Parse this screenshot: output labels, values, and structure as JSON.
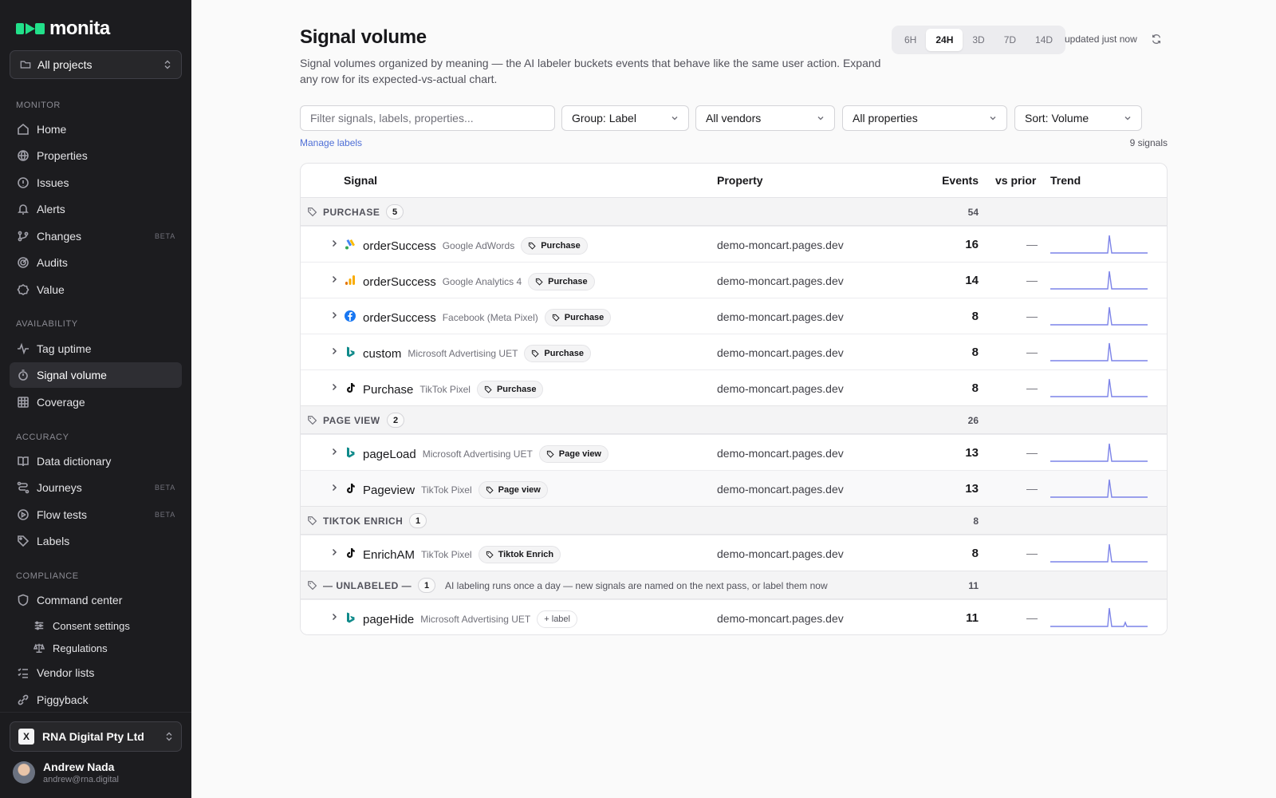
{
  "app": {
    "name": "monita",
    "brand_color": "#22e08a"
  },
  "project_selector": {
    "label": "All projects"
  },
  "nav": {
    "monitor": {
      "title": "MONITOR",
      "items": [
        {
          "label": "Home",
          "icon": "home-icon"
        },
        {
          "label": "Properties",
          "icon": "globe-icon"
        },
        {
          "label": "Issues",
          "icon": "alert-circle-icon"
        },
        {
          "label": "Alerts",
          "icon": "bell-icon"
        },
        {
          "label": "Changes",
          "icon": "git-branch-icon",
          "badge": "BETA"
        },
        {
          "label": "Audits",
          "icon": "target-icon"
        },
        {
          "label": "Value",
          "icon": "badge-icon"
        }
      ]
    },
    "availability": {
      "title": "AVAILABILITY",
      "items": [
        {
          "label": "Tag uptime",
          "icon": "activity-icon"
        },
        {
          "label": "Signal volume",
          "icon": "stopwatch-icon",
          "active": true
        },
        {
          "label": "Coverage",
          "icon": "grid-icon"
        }
      ]
    },
    "accuracy": {
      "title": "ACCURACY",
      "items": [
        {
          "label": "Data dictionary",
          "icon": "book-icon"
        },
        {
          "label": "Journeys",
          "icon": "route-icon",
          "badge": "BETA"
        },
        {
          "label": "Flow tests",
          "icon": "play-circle-icon",
          "badge": "BETA"
        },
        {
          "label": "Labels",
          "icon": "tag-icon"
        }
      ]
    },
    "compliance": {
      "title": "COMPLIANCE",
      "items": [
        {
          "label": "Command center",
          "icon": "shield-icon"
        },
        {
          "label": "Consent settings",
          "icon": "sliders-icon"
        },
        {
          "label": "Regulations",
          "icon": "scale-icon"
        },
        {
          "label": "Vendor lists",
          "icon": "list-check-icon"
        },
        {
          "label": "Piggyback",
          "icon": "chain-icon"
        }
      ]
    }
  },
  "org": {
    "name": "RNA Digital Pty Ltd",
    "logo_text": "X"
  },
  "user": {
    "name": "Andrew Nada",
    "email": "andrew@rna.digital"
  },
  "page": {
    "title": "Signal volume",
    "subtitle": "Signal volumes organized by meaning — the AI labeler buckets events that behave like the same user action. Expand any row for its expected-vs-actual chart.",
    "ranges": [
      "6H",
      "24H",
      "3D",
      "7D",
      "14D"
    ],
    "active_range": "24H",
    "updated": "updated just now"
  },
  "toolbar": {
    "filter_placeholder": "Filter signals, labels, properties...",
    "group": "Group: Label",
    "vendors": "All vendors",
    "properties": "All properties",
    "sort": "Sort: Volume",
    "manage_labels": "Manage labels",
    "signal_count": "9 signals"
  },
  "table": {
    "columns": {
      "signal": "Signal",
      "property": "Property",
      "events": "Events",
      "vs_prior": "vs prior",
      "trend": "Trend"
    },
    "groups": [
      {
        "name": "PURCHASE",
        "count": "5",
        "total": "54",
        "rows": [
          {
            "signal": "orderSuccess",
            "vendor": "Google AdWords",
            "vendor_icon": "google-ads-icon",
            "label": "Purchase",
            "property": "demo-moncart.pages.dev",
            "events": "16",
            "vs": "—"
          },
          {
            "signal": "orderSuccess",
            "vendor": "Google Analytics 4",
            "vendor_icon": "google-analytics-icon",
            "label": "Purchase",
            "property": "demo-moncart.pages.dev",
            "events": "14",
            "vs": "—"
          },
          {
            "signal": "orderSuccess",
            "vendor": "Facebook (Meta Pixel)",
            "vendor_icon": "facebook-icon",
            "label": "Purchase",
            "property": "demo-moncart.pages.dev",
            "events": "8",
            "vs": "—"
          },
          {
            "signal": "custom",
            "vendor": "Microsoft Advertising UET",
            "vendor_icon": "bing-icon",
            "label": "Purchase",
            "property": "demo-moncart.pages.dev",
            "events": "8",
            "vs": "—"
          },
          {
            "signal": "Purchase",
            "vendor": "TikTok Pixel",
            "vendor_icon": "tiktok-icon",
            "label": "Purchase",
            "property": "demo-moncart.pages.dev",
            "events": "8",
            "vs": "—"
          }
        ]
      },
      {
        "name": "PAGE VIEW",
        "count": "2",
        "total": "26",
        "rows": [
          {
            "signal": "pageLoad",
            "vendor": "Microsoft Advertising UET",
            "vendor_icon": "bing-icon",
            "label": "Page view",
            "property": "demo-moncart.pages.dev",
            "events": "13",
            "vs": "—"
          },
          {
            "signal": "Pageview",
            "vendor": "TikTok Pixel",
            "vendor_icon": "tiktok-icon",
            "label": "Page view",
            "property": "demo-moncart.pages.dev",
            "events": "13",
            "vs": "—"
          }
        ]
      },
      {
        "name": "TIKTOK ENRICH",
        "count": "1",
        "total": "8",
        "rows": [
          {
            "signal": "EnrichAM",
            "vendor": "TikTok Pixel",
            "vendor_icon": "tiktok-icon",
            "label": "Tiktok Enrich",
            "property": "demo-moncart.pages.dev",
            "events": "8",
            "vs": "—"
          }
        ]
      },
      {
        "name": "— UNLABELED —",
        "count": "1",
        "total": "11",
        "note": "AI labeling runs once a day — new signals are named on the next pass, or label them now",
        "rows": [
          {
            "signal": "pageHide",
            "vendor": "Microsoft Advertising UET",
            "vendor_icon": "bing-icon",
            "label": "+ label",
            "add": true,
            "property": "demo-moncart.pages.dev",
            "events": "11",
            "vs": "—"
          }
        ]
      }
    ]
  },
  "colors": {
    "trend_line": "#7c83e8",
    "link": "#4f6fd6",
    "sidebar_bg": "#1c1c1f"
  }
}
